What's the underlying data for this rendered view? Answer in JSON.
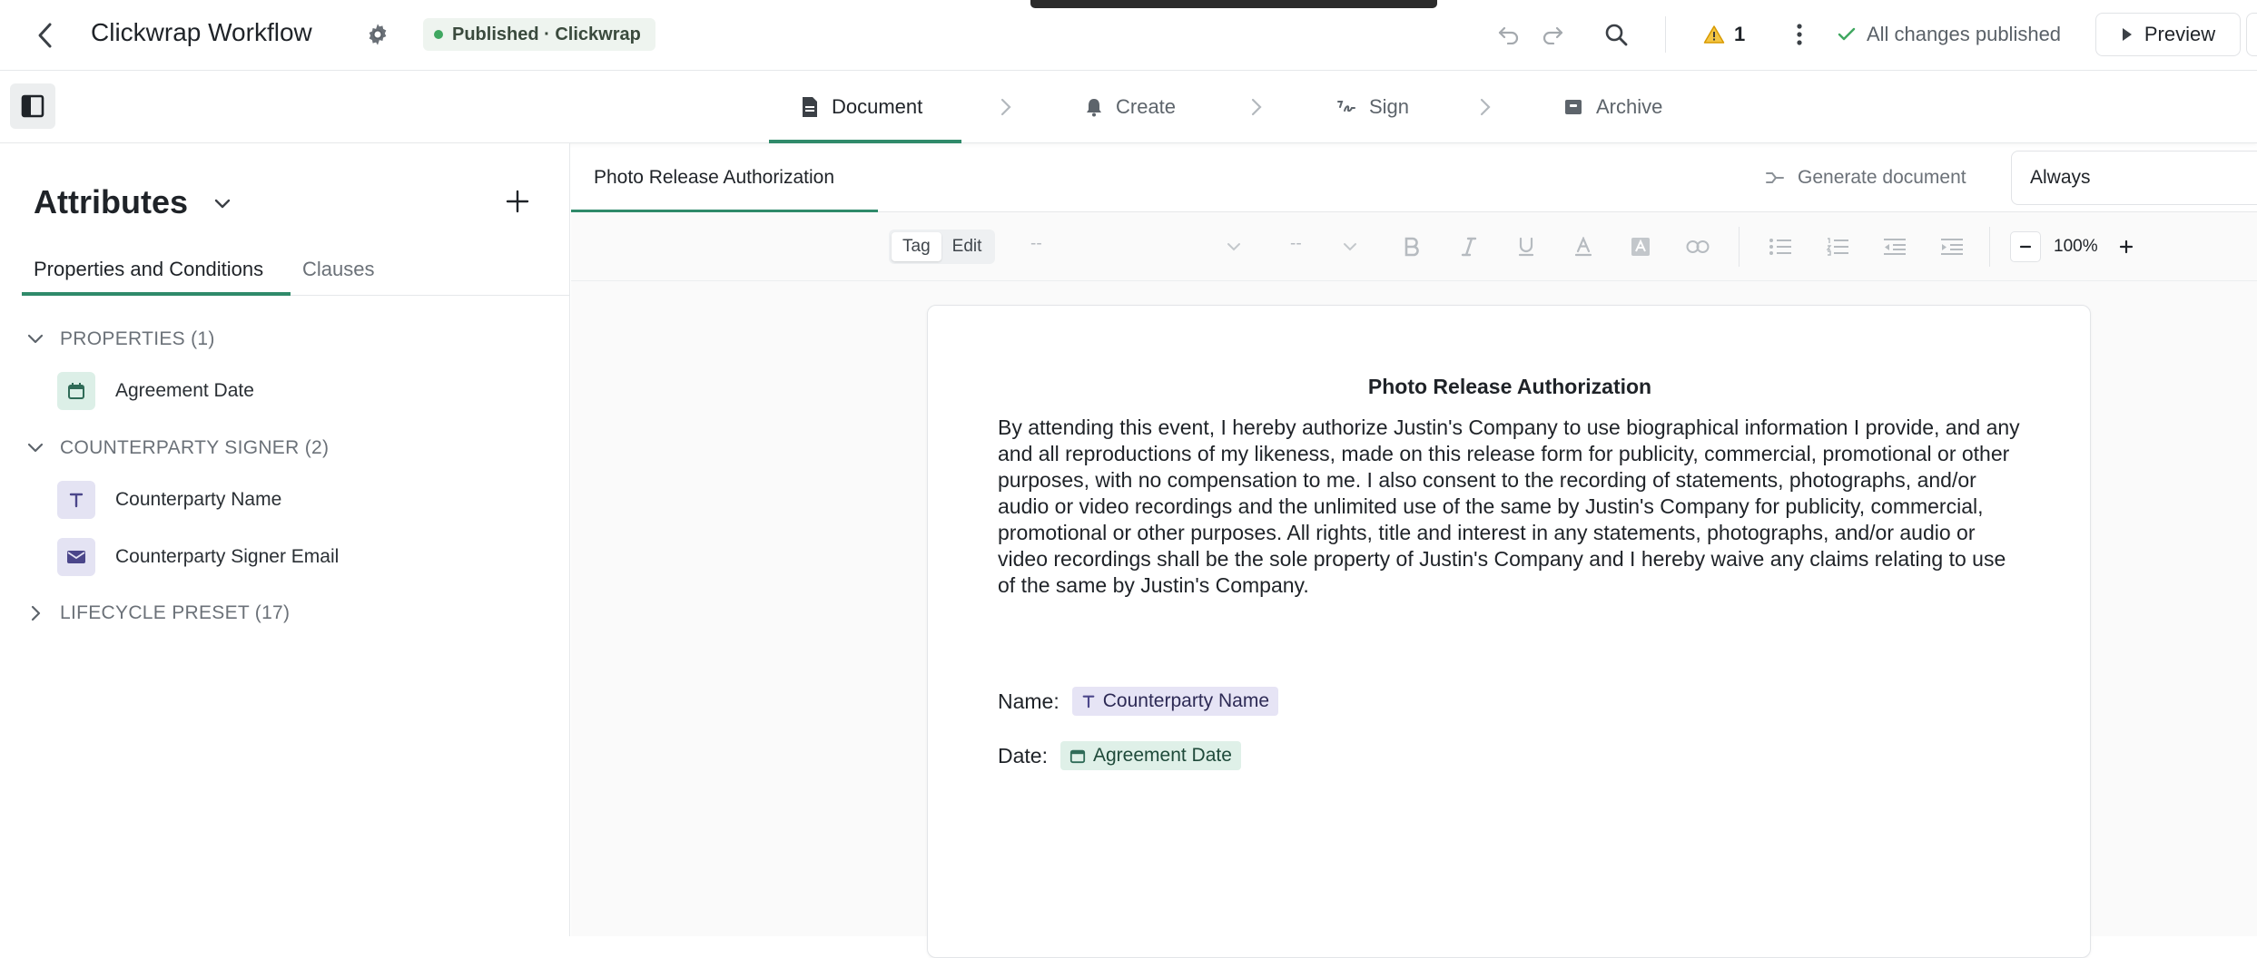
{
  "header": {
    "app_title": "Clickwrap Workflow",
    "status_label": "Published · Clickwrap",
    "warning_count": "1",
    "publish_status": "All changes published",
    "preview_label": "Preview"
  },
  "steps": [
    {
      "label": "Document",
      "active": true
    },
    {
      "label": "Create",
      "active": false
    },
    {
      "label": "Sign",
      "active": false
    },
    {
      "label": "Archive",
      "active": false
    }
  ],
  "sidebar": {
    "title": "Attributes",
    "tabs": [
      {
        "label": "Properties and Conditions",
        "active": true
      },
      {
        "label": "Clauses",
        "active": false
      }
    ],
    "groups": [
      {
        "label": "PROPERTIES (1)",
        "expanded": true,
        "items": [
          {
            "label": "Agreement Date",
            "icon": "calendar-icon"
          }
        ]
      },
      {
        "label": "COUNTERPARTY SIGNER (2)",
        "expanded": true,
        "items": [
          {
            "label": "Counterparty Name",
            "icon": "text-type-icon"
          },
          {
            "label": "Counterparty Signer Email",
            "icon": "email-icon"
          }
        ]
      },
      {
        "label": "LIFECYCLE PRESET (17)",
        "expanded": false,
        "items": []
      }
    ]
  },
  "editor": {
    "doc_tab": "Photo Release Authorization",
    "generate_label": "Generate document",
    "generate_condition": "Always",
    "mode_options": [
      "Tag",
      "Edit"
    ],
    "style_placeholder": "--",
    "size_placeholder": "--",
    "zoom": "100%"
  },
  "document": {
    "title": "Photo Release Authorization",
    "body": "By attending this event, I hereby authorize Justin's Company to use biographical information I provide, and any and all reproductions of my likeness, made on this release form for publicity, commercial, promotional or other purposes, with no compensation to me. I also consent to the recording of statements, photographs, and/or audio or video recordings and the unlimited use of the same by Justin's Company for publicity, commercial, promotional or other purposes. All rights, title and interest in any statements, photographs, and/or audio or video recordings shall be the sole property of Justin's Company and I hereby waive any claims relating to use of the same by Justin's Company.",
    "name_label": "Name:",
    "name_field": "Counterparty Name",
    "date_label": "Date:",
    "date_field": "Agreement Date"
  },
  "colors": {
    "accent": "#2f8a6a",
    "published_dot": "#3fa760",
    "warning": "#e0a800",
    "text_chip": "#e6e4f5",
    "date_chip": "#dff0e8"
  }
}
